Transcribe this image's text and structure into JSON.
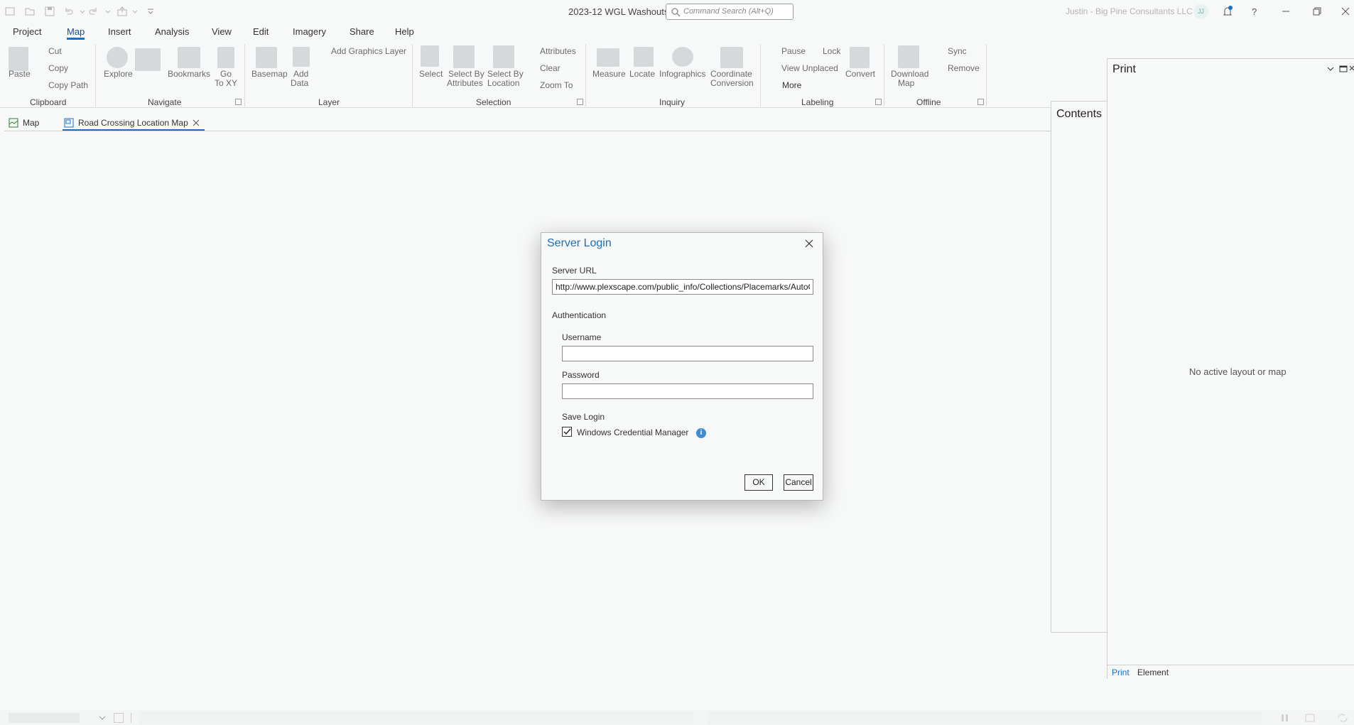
{
  "app": {
    "doc_title": "2023-12 WGL Washouts",
    "search_placeholder": "Command Search (Alt+Q)",
    "user": "Justin - Big Pine Consultants LLC",
    "avatar_initials": "JJ"
  },
  "menu": {
    "tabs": [
      "Project",
      "Map",
      "Insert",
      "Analysis",
      "View",
      "Edit",
      "Imagery",
      "Share",
      "Help"
    ],
    "active": "Map"
  },
  "ribbon": {
    "clipboard": {
      "paste": "Paste",
      "cut": "Cut",
      "copy": "Copy",
      "copy_path": "Copy Path",
      "group": "Clipboard"
    },
    "navigate": {
      "explore": "Explore",
      "bookmarks": "Bookmarks",
      "go_to_xy_1": "Go",
      "go_to_xy_2": "To XY",
      "group": "Navigate"
    },
    "layer": {
      "basemap": "Basemap",
      "add_data_1": "Add",
      "add_data_2": "Data",
      "add_graphics": "Add Graphics Layer",
      "group": "Layer"
    },
    "selection": {
      "select": "Select",
      "by_attr_1": "Select By",
      "by_attr_2": "Attributes",
      "by_loc_1": "Select By",
      "by_loc_2": "Location",
      "attributes": "Attributes",
      "clear": "Clear",
      "zoom_to": "Zoom To",
      "group": "Selection"
    },
    "inquiry": {
      "measure": "Measure",
      "locate": "Locate",
      "infographics": "Infographics",
      "coord_1": "Coordinate",
      "coord_2": "Conversion",
      "group": "Inquiry"
    },
    "labeling": {
      "pause": "Pause",
      "lock": "Lock",
      "view_unplaced": "View Unplaced",
      "more": "More",
      "convert": "Convert",
      "group": "Labeling"
    },
    "offline": {
      "download_1": "Download",
      "download_2": "Map",
      "sync": "Sync",
      "remove": "Remove",
      "group": "Offline"
    }
  },
  "view_tabs": [
    {
      "label": "Map"
    },
    {
      "label": "Road Crossing Location Map"
    }
  ],
  "contents": {
    "title": "Contents"
  },
  "print_pane": {
    "title": "Print",
    "message": "No active layout or map",
    "tabs": [
      "Print",
      "Element"
    ]
  },
  "dialog": {
    "title": "Server Login",
    "server_url_label": "Server URL",
    "server_url_value": "http://www.plexscape.com/public_info/Collections/Placemarks/AutoCAD",
    "auth_label": "Authentication",
    "username_label": "Username",
    "username_value": "",
    "password_label": "Password",
    "password_value": "",
    "save_login_label": "Save Login",
    "credential_manager_label": "Windows Credential Manager",
    "credential_manager_checked": true,
    "ok": "OK",
    "cancel": "Cancel"
  },
  "colors": {
    "accent": "#1a70c7",
    "dialog_title": "#1f6fb4",
    "info": "#3e8bd6"
  }
}
